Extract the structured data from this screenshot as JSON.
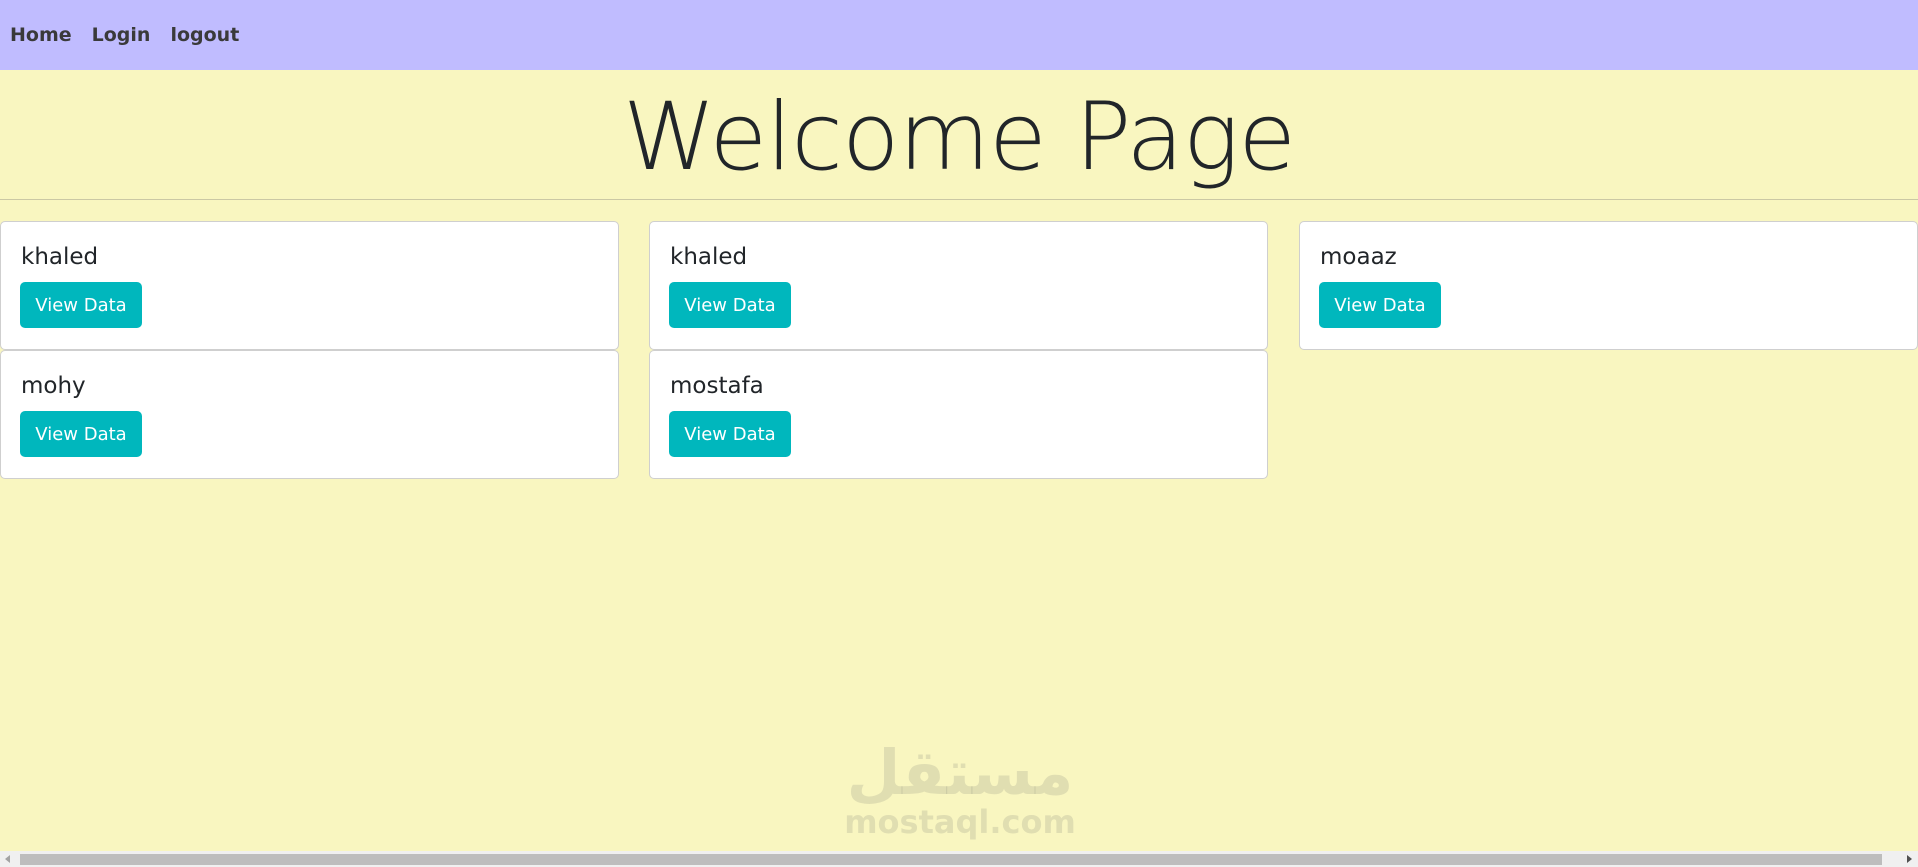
{
  "nav": {
    "items": [
      {
        "label": "Home"
      },
      {
        "label": "Login"
      },
      {
        "label": "logout"
      }
    ]
  },
  "header": {
    "title": "Welcome Page"
  },
  "cards": [
    {
      "name": "khaled",
      "button_label": "View Data"
    },
    {
      "name": "khaled",
      "button_label": "View Data"
    },
    {
      "name": "moaaz",
      "button_label": "View Data"
    },
    {
      "name": "mohy",
      "button_label": "View Data"
    },
    {
      "name": "mostafa",
      "button_label": "View Data"
    }
  ],
  "watermark": {
    "logo_text": "مستقل",
    "text": "mostaql.com"
  },
  "colors": {
    "navbar": "#c0bcff",
    "background": "#f9f6c0",
    "button": "#00b7bd"
  }
}
